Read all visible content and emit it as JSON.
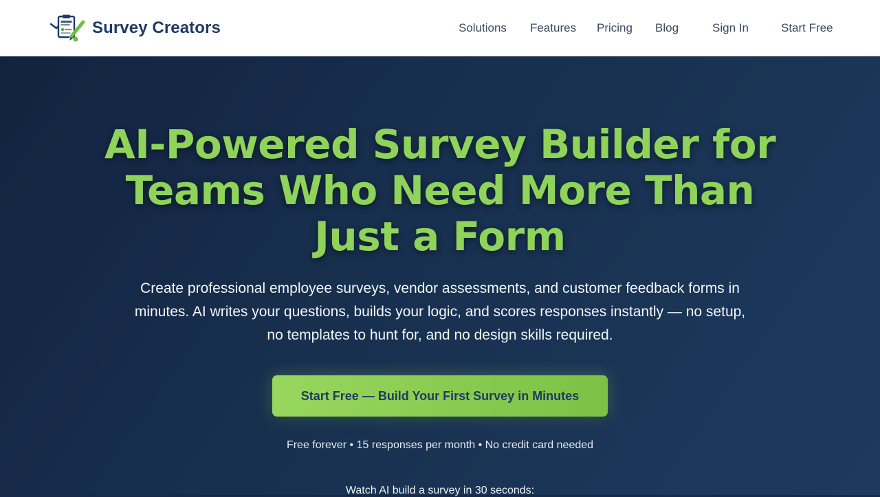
{
  "brand": {
    "name": "Survey Creators",
    "logo_text": "Survey Creators",
    "logo_icon": "clipboard-check-icon",
    "brand_color": "#1e3a64",
    "accent_color": "#8fd35a"
  },
  "nav": {
    "items": [
      {
        "label": "Solutions"
      },
      {
        "label": "Features"
      },
      {
        "label": "Pricing"
      },
      {
        "label": "Blog"
      }
    ],
    "sign_in": "Sign In",
    "start_free": "Start Free"
  },
  "hero": {
    "title": "AI-Powered Survey Builder for Teams Who Need More Than Just a Form",
    "subtitle": "Create professional employee surveys, vendor assessments, and customer feedback forms in minutes. AI writes your questions, builds your logic, and scores responses instantly — no setup, no templates to hunt for, and no design skills required.",
    "cta_label": "Start Free — Build Your First Survey in Minutes",
    "fineprint": "Free forever • 15 responses per month • No credit card needed",
    "watch_label": "Watch AI build a survey in 30 seconds:"
  },
  "colors": {
    "header_bg": "#ffffff",
    "hero_bg": "#16294a",
    "cta_bg": "#8fd35a",
    "cta_text": "#1f3a5f"
  }
}
